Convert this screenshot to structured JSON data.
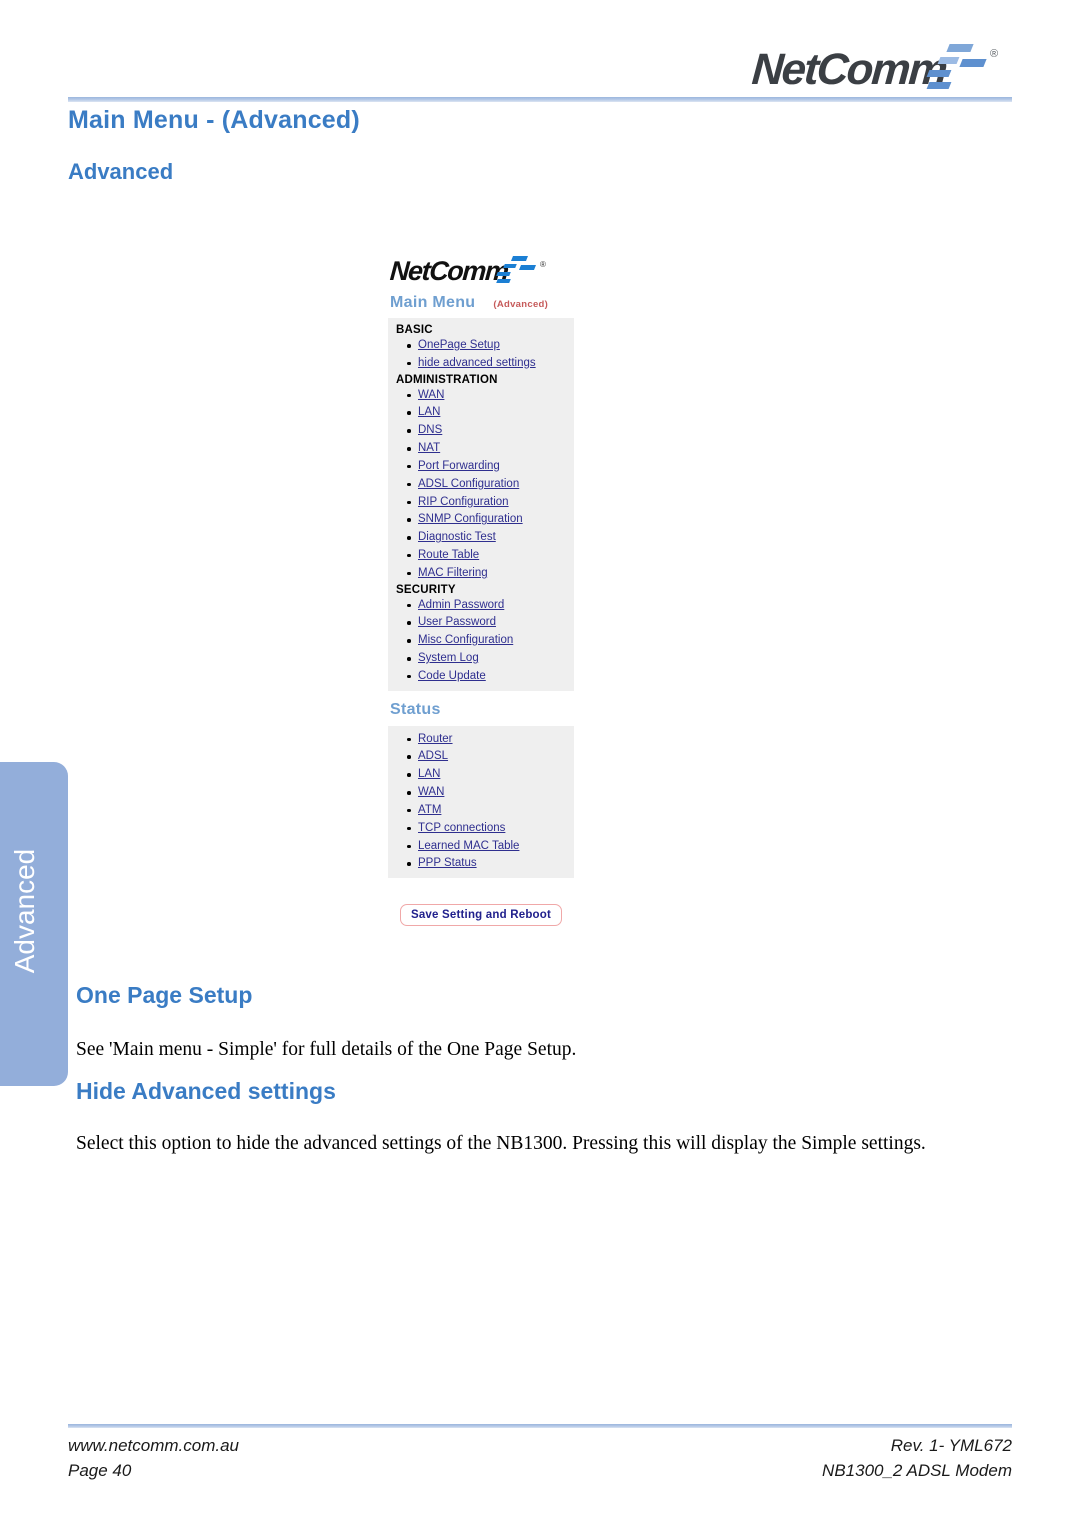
{
  "header": {
    "logo_text": "NetComm",
    "logo_registered": "®",
    "title": "Main Menu - (Advanced)",
    "subtitle": "Advanced"
  },
  "side_tab": {
    "label": "Advanced"
  },
  "screenshot": {
    "logo_text": "NetComm",
    "logo_registered": "®",
    "title": "Main Menu",
    "title_tag": "(Advanced)",
    "groups": [
      {
        "heading": "BASIC",
        "items": [
          "OnePage Setup",
          "hide advanced settings"
        ]
      },
      {
        "heading": "ADMINISTRATION",
        "items": [
          "WAN",
          "LAN",
          "DNS",
          "NAT",
          "Port Forwarding",
          "ADSL Configuration",
          "RIP Configuration",
          "SNMP Configuration",
          "Diagnostic Test",
          "Route Table",
          "MAC Filtering"
        ]
      },
      {
        "heading": "SECURITY",
        "items": [
          "Admin Password",
          "User Password",
          "Misc Configuration",
          "System Log",
          "Code Update"
        ]
      }
    ],
    "status_heading": "Status",
    "status_items": [
      "Router",
      "ADSL",
      "LAN",
      "WAN",
      "ATM",
      "TCP connections",
      "Learned MAC Table",
      "PPP Status"
    ],
    "save_button": "Save Setting and Reboot"
  },
  "sections": {
    "one_page_setup": {
      "heading": "One Page Setup",
      "paragraph": "See 'Main menu - Simple' for full details of the One Page Setup."
    },
    "hide_advanced": {
      "heading": "Hide Advanced settings",
      "paragraph": "Select this option to hide the advanced settings of the NB1300. Pressing this will display the Simple settings."
    }
  },
  "footer": {
    "website": "www.netcomm.com.au",
    "page": "Page 40",
    "revision": "Rev. 1- YML672",
    "product": "NB1300_2 ADSL Modem"
  },
  "colors": {
    "heading_blue": "#3a7cc4",
    "rule_blue": "#9bb6dd",
    "tab_blue": "#93aeda",
    "shot_title_blue": "#6f9fd0",
    "shot_tag_red": "#c65a5a",
    "shot_link_blue": "#2f2f8f",
    "shot_button_border": "#f0a8a8",
    "shot_panel_bg": "#efefef"
  }
}
